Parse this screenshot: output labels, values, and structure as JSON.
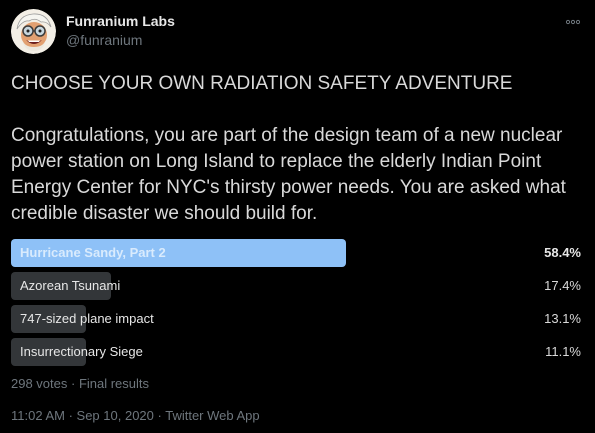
{
  "author": {
    "display_name": "Funranium Labs",
    "handle": "@funranium",
    "avatar_icon": "cartoon-scientist-avatar"
  },
  "menu": {
    "more_icon": "more-horizontal-icon"
  },
  "tweet": {
    "headline": "CHOOSE YOUR OWN RADIATION SAFETY ADVENTURE",
    "body": "Congratulations, you are part of the design team of a new nuclear power station on Long Island to replace the elderly Indian Point Energy Center for NYC's thirsty power needs. You are asked what credible disaster we should build for."
  },
  "poll": {
    "options": [
      {
        "label": "Hurricane Sandy, Part 2",
        "percent_text": "58.4%",
        "percent": 58.4,
        "winner": true
      },
      {
        "label": "Azorean Tsunami",
        "percent_text": "17.4%",
        "percent": 17.4,
        "winner": false
      },
      {
        "label": "747-sized plane impact",
        "percent_text": "13.1%",
        "percent": 13.1,
        "winner": false
      },
      {
        "label": "Insurrectionary Siege",
        "percent_text": "11.1%",
        "percent": 11.1,
        "winner": false
      }
    ],
    "votes": "298 votes",
    "status": "Final results",
    "separator": " · "
  },
  "meta": {
    "time": "11:02 AM",
    "date": "Sep 10, 2020",
    "source": "Twitter Web App",
    "separator": " · "
  },
  "colors": {
    "background": "#000000",
    "winner_bar": "#8ec1f7",
    "bar": "#333639",
    "secondary_text": "#6e767d"
  }
}
